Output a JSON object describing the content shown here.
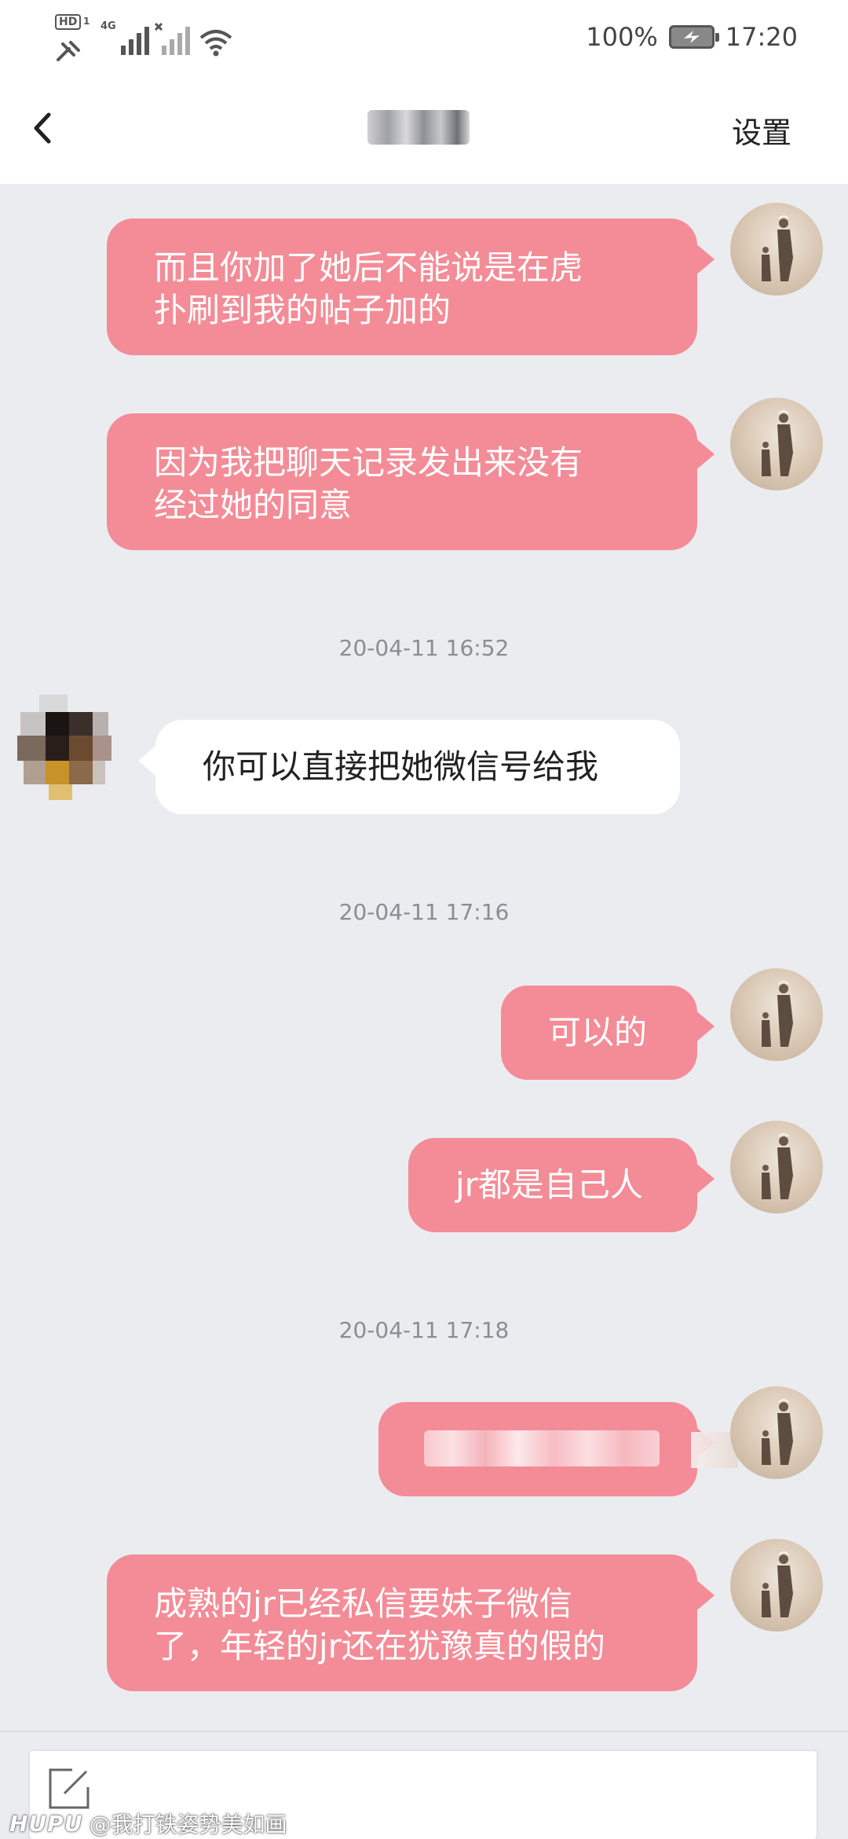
{
  "status_bar": {
    "hd": "HD",
    "sim1": "1",
    "network": "4G",
    "battery": "100%",
    "time": "17:20"
  },
  "nav": {
    "settings_label": "设置"
  },
  "messages": [
    {
      "sender": "me",
      "text_lines": [
        "而且你加了她后不能说是在虎",
        "扑刷到我的帖子加的"
      ]
    },
    {
      "sender": "me",
      "text_lines": [
        "因为我把聊天记录发出来没有",
        "经过她的同意"
      ]
    },
    {
      "sender": "them",
      "text_lines": [
        "你可以直接把她微信号给我"
      ]
    },
    {
      "sender": "me",
      "text_lines": [
        "可以的"
      ]
    },
    {
      "sender": "me",
      "text_lines": [
        "jr都是自己人"
      ]
    },
    {
      "sender": "me",
      "text_lines": []
    },
    {
      "sender": "me",
      "text_lines": [
        "成熟的jr已经私信要妹子微信",
        "了，年轻的jr还在犹豫真的假的"
      ]
    }
  ],
  "timestamps": [
    "20-04-11 16:52",
    "20-04-11 17:16",
    "20-04-11 17:18"
  ],
  "watermark": {
    "brand": "HUPU",
    "text": "@我打铁姿势美如画"
  },
  "colors": {
    "my_bubble": "#f38c97",
    "their_bubble": "#ffffff",
    "background": "#ebecf0"
  }
}
